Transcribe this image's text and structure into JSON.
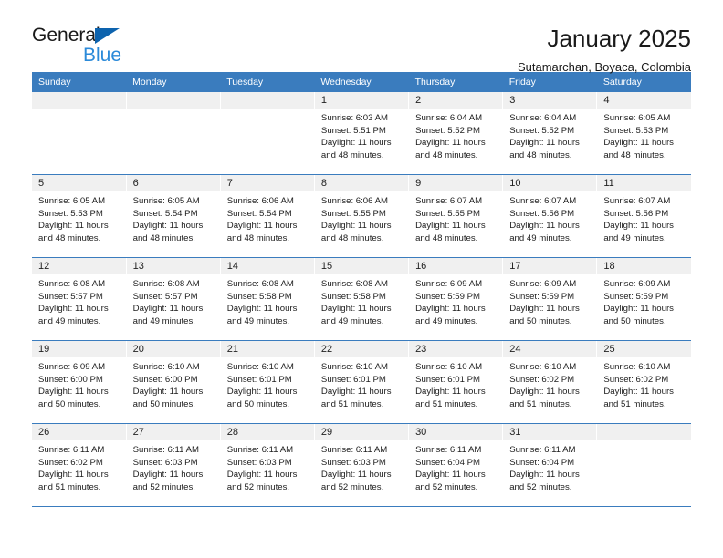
{
  "brand": {
    "line1": "General",
    "line2": "Blue",
    "triangle_color": "#0d63ae",
    "line2_color": "#2b8ad9"
  },
  "header": {
    "title": "January 2025",
    "subtitle": "Sutamarchan, Boyaca, Colombia"
  },
  "theme": {
    "header_row_bg": "#3a7cbe",
    "header_row_text": "#ffffff",
    "daynum_band_bg": "#f0f0f0",
    "grid_line": "#3a7cbe"
  },
  "calendar": {
    "weekday_headers": [
      "Sunday",
      "Monday",
      "Tuesday",
      "Wednesday",
      "Thursday",
      "Friday",
      "Saturday"
    ],
    "labels": {
      "sunrise": "Sunrise:",
      "sunset": "Sunset:",
      "daylight": "Daylight:"
    },
    "weeks": [
      [
        {
          "day": "",
          "sunrise": "",
          "sunset": "",
          "daylight": "",
          "empty": true
        },
        {
          "day": "",
          "sunrise": "",
          "sunset": "",
          "daylight": "",
          "empty": true
        },
        {
          "day": "",
          "sunrise": "",
          "sunset": "",
          "daylight": "",
          "empty": true
        },
        {
          "day": "1",
          "sunrise": "Sunrise: 6:03 AM",
          "sunset": "Sunset: 5:51 PM",
          "daylight_l1": "Daylight: 11 hours",
          "daylight_l2": "and 48 minutes."
        },
        {
          "day": "2",
          "sunrise": "Sunrise: 6:04 AM",
          "sunset": "Sunset: 5:52 PM",
          "daylight_l1": "Daylight: 11 hours",
          "daylight_l2": "and 48 minutes."
        },
        {
          "day": "3",
          "sunrise": "Sunrise: 6:04 AM",
          "sunset": "Sunset: 5:52 PM",
          "daylight_l1": "Daylight: 11 hours",
          "daylight_l2": "and 48 minutes."
        },
        {
          "day": "4",
          "sunrise": "Sunrise: 6:05 AM",
          "sunset": "Sunset: 5:53 PM",
          "daylight_l1": "Daylight: 11 hours",
          "daylight_l2": "and 48 minutes."
        }
      ],
      [
        {
          "day": "5",
          "sunrise": "Sunrise: 6:05 AM",
          "sunset": "Sunset: 5:53 PM",
          "daylight_l1": "Daylight: 11 hours",
          "daylight_l2": "and 48 minutes."
        },
        {
          "day": "6",
          "sunrise": "Sunrise: 6:05 AM",
          "sunset": "Sunset: 5:54 PM",
          "daylight_l1": "Daylight: 11 hours",
          "daylight_l2": "and 48 minutes."
        },
        {
          "day": "7",
          "sunrise": "Sunrise: 6:06 AM",
          "sunset": "Sunset: 5:54 PM",
          "daylight_l1": "Daylight: 11 hours",
          "daylight_l2": "and 48 minutes."
        },
        {
          "day": "8",
          "sunrise": "Sunrise: 6:06 AM",
          "sunset": "Sunset: 5:55 PM",
          "daylight_l1": "Daylight: 11 hours",
          "daylight_l2": "and 48 minutes."
        },
        {
          "day": "9",
          "sunrise": "Sunrise: 6:07 AM",
          "sunset": "Sunset: 5:55 PM",
          "daylight_l1": "Daylight: 11 hours",
          "daylight_l2": "and 48 minutes."
        },
        {
          "day": "10",
          "sunrise": "Sunrise: 6:07 AM",
          "sunset": "Sunset: 5:56 PM",
          "daylight_l1": "Daylight: 11 hours",
          "daylight_l2": "and 49 minutes."
        },
        {
          "day": "11",
          "sunrise": "Sunrise: 6:07 AM",
          "sunset": "Sunset: 5:56 PM",
          "daylight_l1": "Daylight: 11 hours",
          "daylight_l2": "and 49 minutes."
        }
      ],
      [
        {
          "day": "12",
          "sunrise": "Sunrise: 6:08 AM",
          "sunset": "Sunset: 5:57 PM",
          "daylight_l1": "Daylight: 11 hours",
          "daylight_l2": "and 49 minutes."
        },
        {
          "day": "13",
          "sunrise": "Sunrise: 6:08 AM",
          "sunset": "Sunset: 5:57 PM",
          "daylight_l1": "Daylight: 11 hours",
          "daylight_l2": "and 49 minutes."
        },
        {
          "day": "14",
          "sunrise": "Sunrise: 6:08 AM",
          "sunset": "Sunset: 5:58 PM",
          "daylight_l1": "Daylight: 11 hours",
          "daylight_l2": "and 49 minutes."
        },
        {
          "day": "15",
          "sunrise": "Sunrise: 6:08 AM",
          "sunset": "Sunset: 5:58 PM",
          "daylight_l1": "Daylight: 11 hours",
          "daylight_l2": "and 49 minutes."
        },
        {
          "day": "16",
          "sunrise": "Sunrise: 6:09 AM",
          "sunset": "Sunset: 5:59 PM",
          "daylight_l1": "Daylight: 11 hours",
          "daylight_l2": "and 49 minutes."
        },
        {
          "day": "17",
          "sunrise": "Sunrise: 6:09 AM",
          "sunset": "Sunset: 5:59 PM",
          "daylight_l1": "Daylight: 11 hours",
          "daylight_l2": "and 50 minutes."
        },
        {
          "day": "18",
          "sunrise": "Sunrise: 6:09 AM",
          "sunset": "Sunset: 5:59 PM",
          "daylight_l1": "Daylight: 11 hours",
          "daylight_l2": "and 50 minutes."
        }
      ],
      [
        {
          "day": "19",
          "sunrise": "Sunrise: 6:09 AM",
          "sunset": "Sunset: 6:00 PM",
          "daylight_l1": "Daylight: 11 hours",
          "daylight_l2": "and 50 minutes."
        },
        {
          "day": "20",
          "sunrise": "Sunrise: 6:10 AM",
          "sunset": "Sunset: 6:00 PM",
          "daylight_l1": "Daylight: 11 hours",
          "daylight_l2": "and 50 minutes."
        },
        {
          "day": "21",
          "sunrise": "Sunrise: 6:10 AM",
          "sunset": "Sunset: 6:01 PM",
          "daylight_l1": "Daylight: 11 hours",
          "daylight_l2": "and 50 minutes."
        },
        {
          "day": "22",
          "sunrise": "Sunrise: 6:10 AM",
          "sunset": "Sunset: 6:01 PM",
          "daylight_l1": "Daylight: 11 hours",
          "daylight_l2": "and 51 minutes."
        },
        {
          "day": "23",
          "sunrise": "Sunrise: 6:10 AM",
          "sunset": "Sunset: 6:01 PM",
          "daylight_l1": "Daylight: 11 hours",
          "daylight_l2": "and 51 minutes."
        },
        {
          "day": "24",
          "sunrise": "Sunrise: 6:10 AM",
          "sunset": "Sunset: 6:02 PM",
          "daylight_l1": "Daylight: 11 hours",
          "daylight_l2": "and 51 minutes."
        },
        {
          "day": "25",
          "sunrise": "Sunrise: 6:10 AM",
          "sunset": "Sunset: 6:02 PM",
          "daylight_l1": "Daylight: 11 hours",
          "daylight_l2": "and 51 minutes."
        }
      ],
      [
        {
          "day": "26",
          "sunrise": "Sunrise: 6:11 AM",
          "sunset": "Sunset: 6:02 PM",
          "daylight_l1": "Daylight: 11 hours",
          "daylight_l2": "and 51 minutes."
        },
        {
          "day": "27",
          "sunrise": "Sunrise: 6:11 AM",
          "sunset": "Sunset: 6:03 PM",
          "daylight_l1": "Daylight: 11 hours",
          "daylight_l2": "and 52 minutes."
        },
        {
          "day": "28",
          "sunrise": "Sunrise: 6:11 AM",
          "sunset": "Sunset: 6:03 PM",
          "daylight_l1": "Daylight: 11 hours",
          "daylight_l2": "and 52 minutes."
        },
        {
          "day": "29",
          "sunrise": "Sunrise: 6:11 AM",
          "sunset": "Sunset: 6:03 PM",
          "daylight_l1": "Daylight: 11 hours",
          "daylight_l2": "and 52 minutes."
        },
        {
          "day": "30",
          "sunrise": "Sunrise: 6:11 AM",
          "sunset": "Sunset: 6:04 PM",
          "daylight_l1": "Daylight: 11 hours",
          "daylight_l2": "and 52 minutes."
        },
        {
          "day": "31",
          "sunrise": "Sunrise: 6:11 AM",
          "sunset": "Sunset: 6:04 PM",
          "daylight_l1": "Daylight: 11 hours",
          "daylight_l2": "and 52 minutes."
        },
        {
          "day": "",
          "sunrise": "",
          "sunset": "",
          "daylight": "",
          "empty": true
        }
      ]
    ]
  }
}
